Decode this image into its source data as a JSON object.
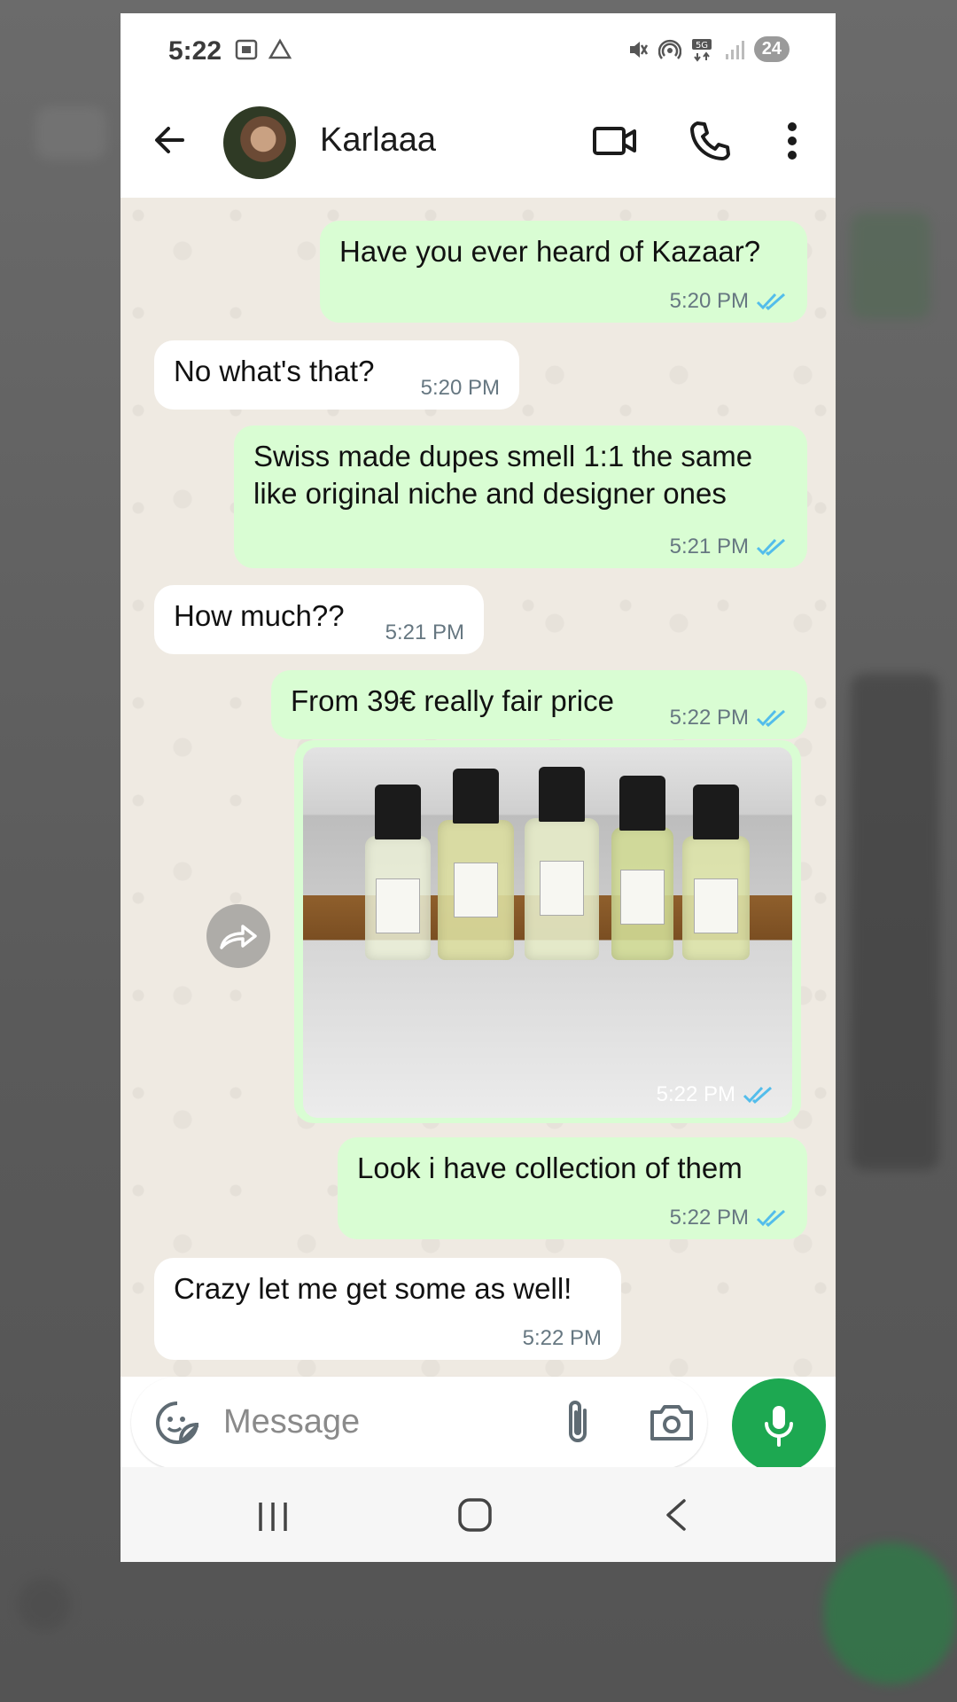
{
  "status_bar": {
    "time": "5:22",
    "battery": "24"
  },
  "header": {
    "contact_name": "Karlaaa"
  },
  "messages": [
    {
      "direction": "out",
      "text": "Have you ever heard of Kazaar?",
      "time": "5:20 PM"
    },
    {
      "direction": "in",
      "text": "No what's that?",
      "time": "5:20 PM"
    },
    {
      "direction": "out",
      "text": "Swiss made dupes smell 1:1 the same like original niche and designer ones",
      "time": "5:21 PM"
    },
    {
      "direction": "in",
      "text": "How much??",
      "time": "5:21 PM"
    },
    {
      "direction": "out",
      "text": "From 39€ really fair price",
      "time": "5:22 PM"
    },
    {
      "direction": "out",
      "type": "image",
      "time": "5:22 PM"
    },
    {
      "direction": "out",
      "text": "Look i have collection of them",
      "time": "5:22 PM"
    },
    {
      "direction": "in",
      "text": "Crazy let me get some as well!",
      "time": "5:22 PM"
    }
  ],
  "composer": {
    "placeholder": "Message"
  },
  "colors": {
    "outgoing_bubble": "#d9fdd3",
    "incoming_bubble": "#ffffff",
    "chat_background": "#efeae2",
    "accent_green": "#1da851",
    "read_ticks": "#53bdeb"
  },
  "icons": [
    "back-arrow-icon",
    "video-call-icon",
    "phone-call-icon",
    "more-options-icon",
    "forward-icon",
    "sticker-icon",
    "attach-icon",
    "camera-icon",
    "mic-icon",
    "double-check-icon"
  ]
}
